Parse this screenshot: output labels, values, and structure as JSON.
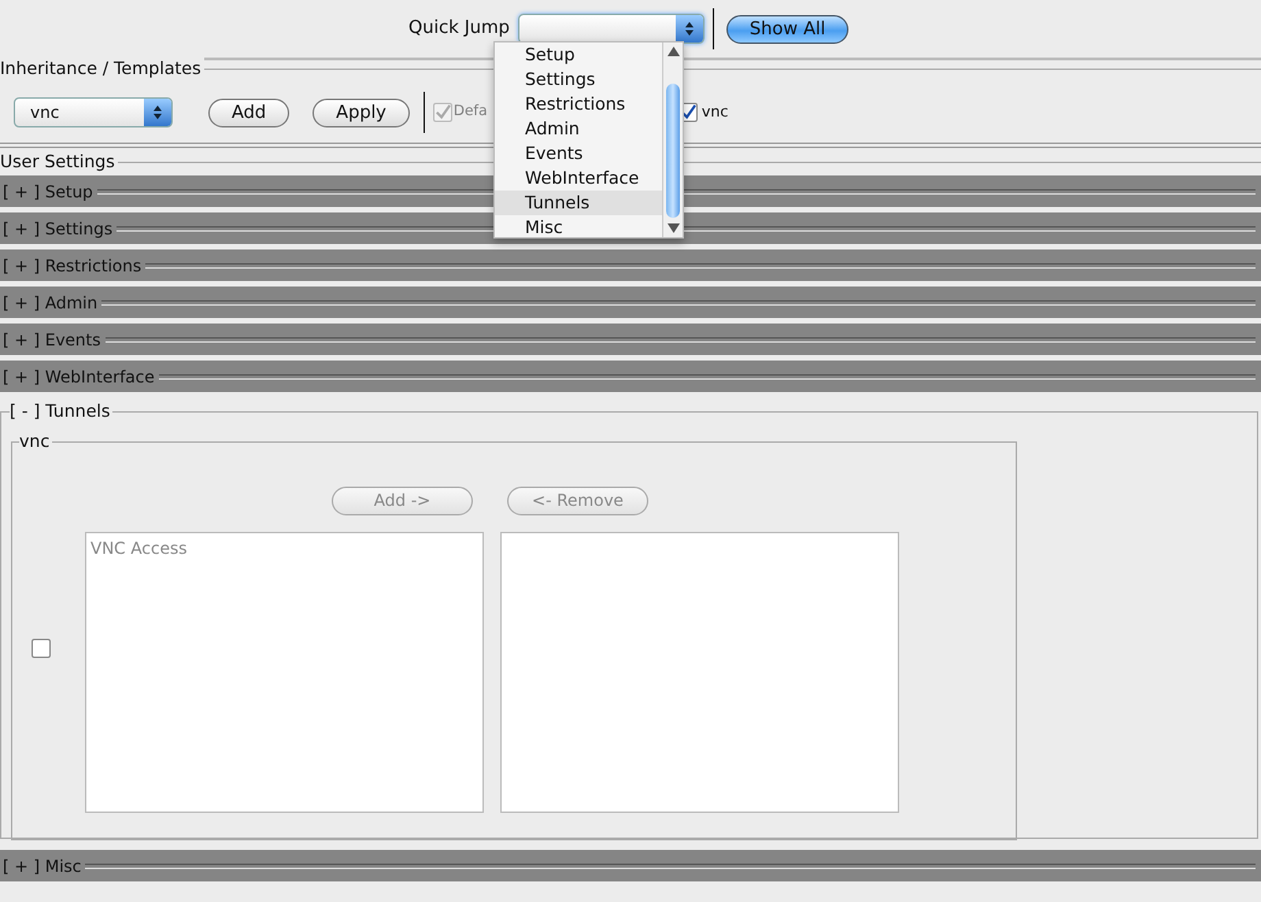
{
  "quick_jump": {
    "label": "Quick Jump",
    "menu": [
      {
        "label": "Setup",
        "selected": false
      },
      {
        "label": "Settings",
        "selected": false
      },
      {
        "label": "Restrictions",
        "selected": false
      },
      {
        "label": "Admin",
        "selected": false
      },
      {
        "label": "Events",
        "selected": false
      },
      {
        "label": "WebInterface",
        "selected": false
      },
      {
        "label": "Tunnels",
        "selected": true
      },
      {
        "label": "Misc",
        "selected": false
      }
    ],
    "show_all": "Show All"
  },
  "templates": {
    "title": "Inheritance / Templates",
    "select_value": "vnc",
    "buttons": [
      "Add",
      "Apply"
    ],
    "checkboxes": [
      {
        "label": "Defa",
        "checked": true,
        "disabled": true
      },
      {
        "label": "vnc",
        "checked": true,
        "disabled": false
      }
    ]
  },
  "user_settings": {
    "title": "User Settings",
    "sections": [
      {
        "toggle": "[ + ]",
        "title": "Setup",
        "expanded": false
      },
      {
        "toggle": "[ + ]",
        "title": "Settings",
        "expanded": false
      },
      {
        "toggle": "[ + ]",
        "title": "Restrictions",
        "expanded": false
      },
      {
        "toggle": "[ + ]",
        "title": "Admin",
        "expanded": false
      },
      {
        "toggle": "[ + ]",
        "title": "Events",
        "expanded": false
      },
      {
        "toggle": "[ + ]",
        "title": "WebInterface",
        "expanded": false
      },
      {
        "toggle": "[ - ]",
        "title": "Tunnels",
        "expanded": true,
        "tunnel": {
          "name": "vnc",
          "checked": false,
          "add_button": "Add ->",
          "remove_button": "<- Remove",
          "available": [
            "VNC Access"
          ]
        }
      },
      {
        "toggle": "[ + ]",
        "title": "Misc",
        "expanded": false
      }
    ]
  }
}
